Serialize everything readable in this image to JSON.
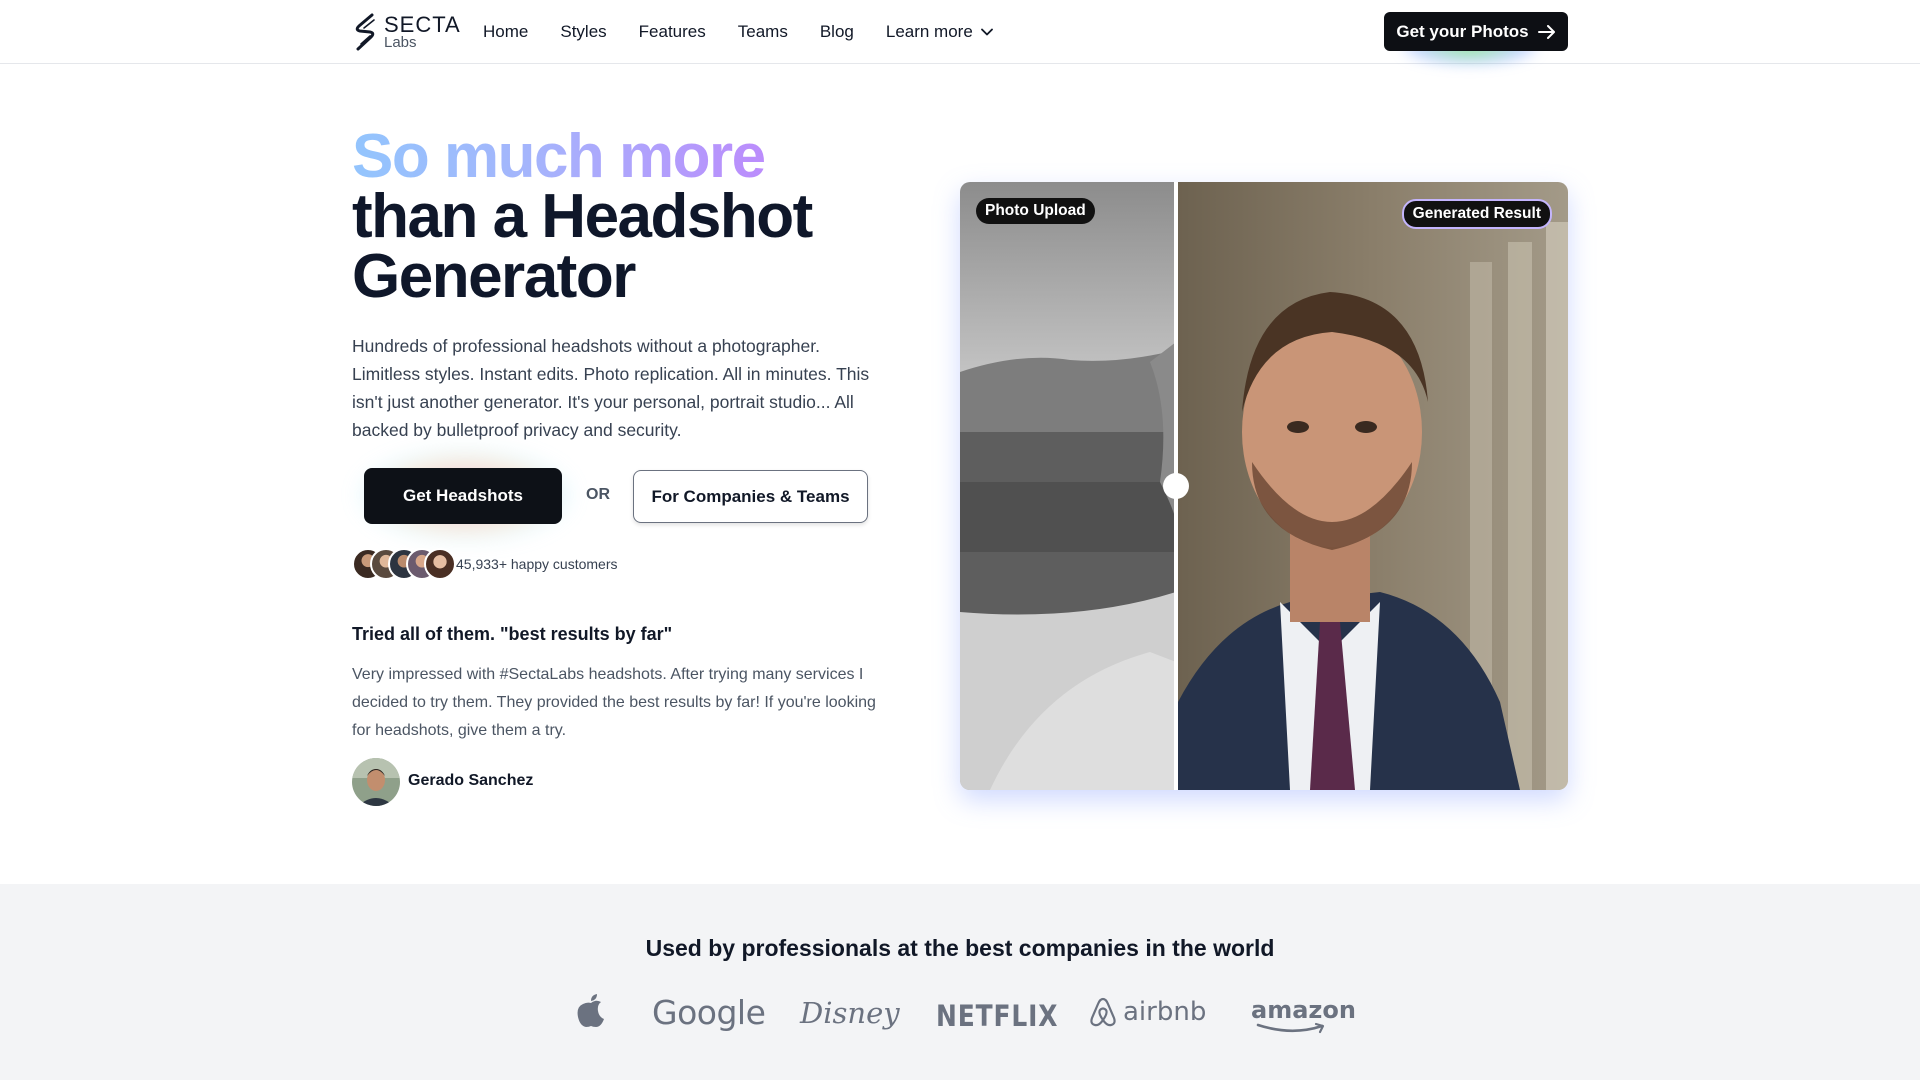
{
  "nav": {
    "logo": {
      "name": "SECTA",
      "sub": "Labs"
    },
    "links": [
      "Home",
      "Styles",
      "Features",
      "Teams",
      "Blog"
    ],
    "more_label": "Learn more",
    "cta_label": "Get your Photos",
    "cta_icon": "arrow-right-icon"
  },
  "hero": {
    "title_highlight": "So much more",
    "title_line2": "than a Headshot",
    "title_line3": "Generator",
    "description": "Hundreds of professional headshots without a photographer. Limitless styles. Instant edits. Photo replication. All in minutes. This isn't just another generator. It's your personal, portrait studio... All backed by bulletproof privacy and security.",
    "primary_cta": "Get Headshots",
    "or_label": "OR",
    "secondary_cta": "For Companies & Teams",
    "customers_label": "45,933+ happy customers"
  },
  "testimonial": {
    "title": "Tried all of them. \"best results by far\"",
    "body": "Very impressed with #SectaLabs headshots. After trying many services I decided to try them. They provided the best results by far! If you're looking for headshots, give them a try.",
    "author": "Gerado Sanchez"
  },
  "comparison": {
    "left_label": "Photo Upload",
    "right_label": "Generated Result"
  },
  "logos": {
    "title": "Used by professionals at the best companies in the world",
    "brands": [
      "Apple",
      "Google",
      "Disney",
      "NETFLIX",
      "airbnb",
      "amazon"
    ]
  },
  "colors": {
    "primary": "#0d1117",
    "title_gradient": [
      "#93c5fd",
      "#a5b4fc",
      "#c084fc"
    ],
    "band_bg": "#f3f4f6"
  }
}
